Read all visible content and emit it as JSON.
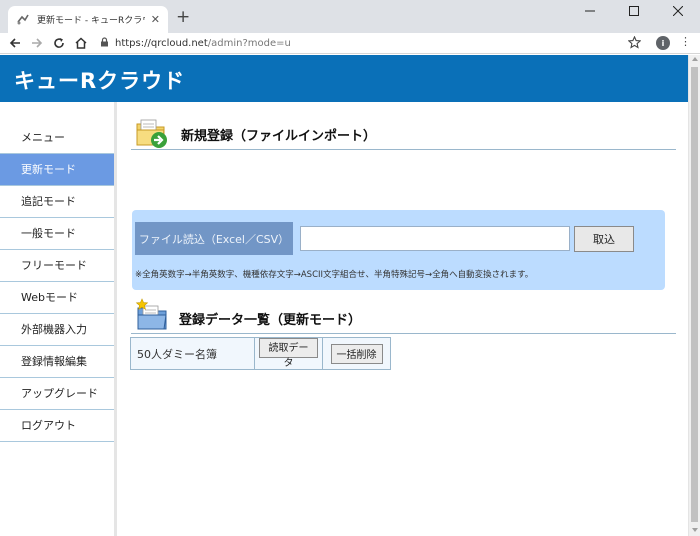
{
  "browser": {
    "tab_title": "更新モード - キューRクラウド",
    "new_tab": "+",
    "url_host": "https://qrcloud.net",
    "url_path": "/admin?mode=u",
    "profile_initial": "i"
  },
  "header": {
    "logo": "キューRクラウド",
    "color": "#0a70b8"
  },
  "sidebar": {
    "items": [
      {
        "label": "メニュー"
      },
      {
        "label": "更新モード",
        "active": true
      },
      {
        "label": "追記モード"
      },
      {
        "label": "一般モード"
      },
      {
        "label": "フリーモード"
      },
      {
        "label": "Webモード"
      },
      {
        "label": "外部機器入力"
      },
      {
        "label": "登録情報編集"
      },
      {
        "label": "アップグレード"
      },
      {
        "label": "ログアウト"
      }
    ]
  },
  "import_section": {
    "title": "新規登録（ファイルインポート）",
    "file_label": "ファイル読込（Excel／CSV）",
    "file_value": "",
    "import_button": "取込",
    "note": "※全角英数字→半角英数字、機種依存文字→ASCII文字組合せ、半角特殊記号→全角へ自動変換されます。"
  },
  "list_section": {
    "title": "登録データ一覧（更新モード）",
    "rows": [
      {
        "name": "50人ダミー名簿",
        "read_button": "読取データ",
        "delete_button": "一括削除"
      }
    ]
  }
}
